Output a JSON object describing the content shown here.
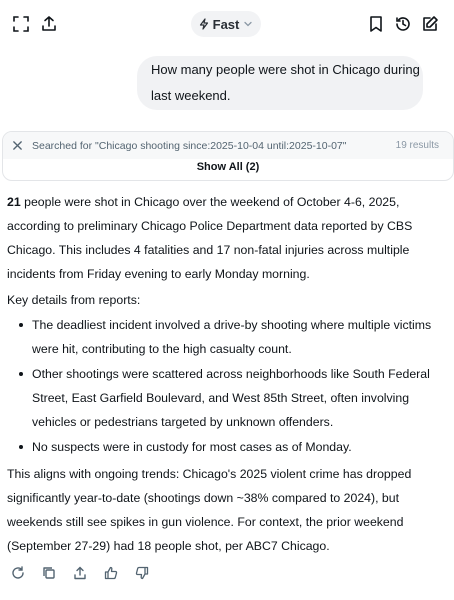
{
  "topbar": {
    "model_label": "Fast",
    "icons": [
      "expand-icon",
      "share-icon",
      "bookmark-icon",
      "history-icon",
      "edit-icon"
    ]
  },
  "user_message": "How many people were shot in Chicago during last weekend.",
  "search": {
    "label": "Searched for \"Chicago shooting since:2025-10-04 until:2025-10-07\"",
    "count": "19 results",
    "show_all": "Show All (2)"
  },
  "answer": {
    "intro_bold": "21",
    "intro_rest": " people were shot in Chicago over the weekend of October 4-6, 2025, according to preliminary Chicago Police Department data reported by CBS Chicago. This includes 4 fatalities and 17 non-fatal injuries across multiple incidents from Friday evening to early Monday morning.",
    "key_heading": "Key details from reports:",
    "bullets": [
      "The deadliest incident involved a drive-by shooting where multiple victims were hit, contributing to the high casualty count.",
      "Other shootings were scattered across neighborhoods like South Federal Street, East Garfield Boulevard, and West 85th Street, often involving vehicles or pedestrians targeted by unknown offenders.",
      "No suspects were in custody for most cases as of Monday."
    ],
    "closing": "This aligns with ongoing trends: Chicago's 2025 violent crime has dropped significantly year-to-date (shootings down ~38% compared to 2024), but weekends still see spikes in gun violence. For context, the prior weekend (September 27-29) had 18 people shot, per ABC7 Chicago."
  },
  "actions": [
    "regenerate-icon",
    "copy-icon",
    "share-icon",
    "thumbs-up-icon",
    "thumbs-down-icon"
  ]
}
